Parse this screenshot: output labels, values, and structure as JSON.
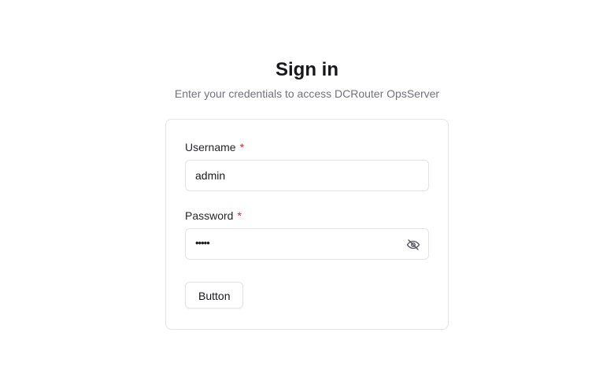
{
  "header": {
    "title": "Sign in",
    "subtitle": "Enter your credentials to access DCRouter OpsServer"
  },
  "form": {
    "username": {
      "label": "Username",
      "required_mark": "*",
      "value": "admin"
    },
    "password": {
      "label": "Password",
      "required_mark": "*",
      "masked_value": "•••••",
      "toggle_icon": "eye-off-icon"
    },
    "submit_label": "Button"
  },
  "colors": {
    "required": "#dc2626",
    "border": "#e4e4e7",
    "muted_text": "#71717a"
  }
}
